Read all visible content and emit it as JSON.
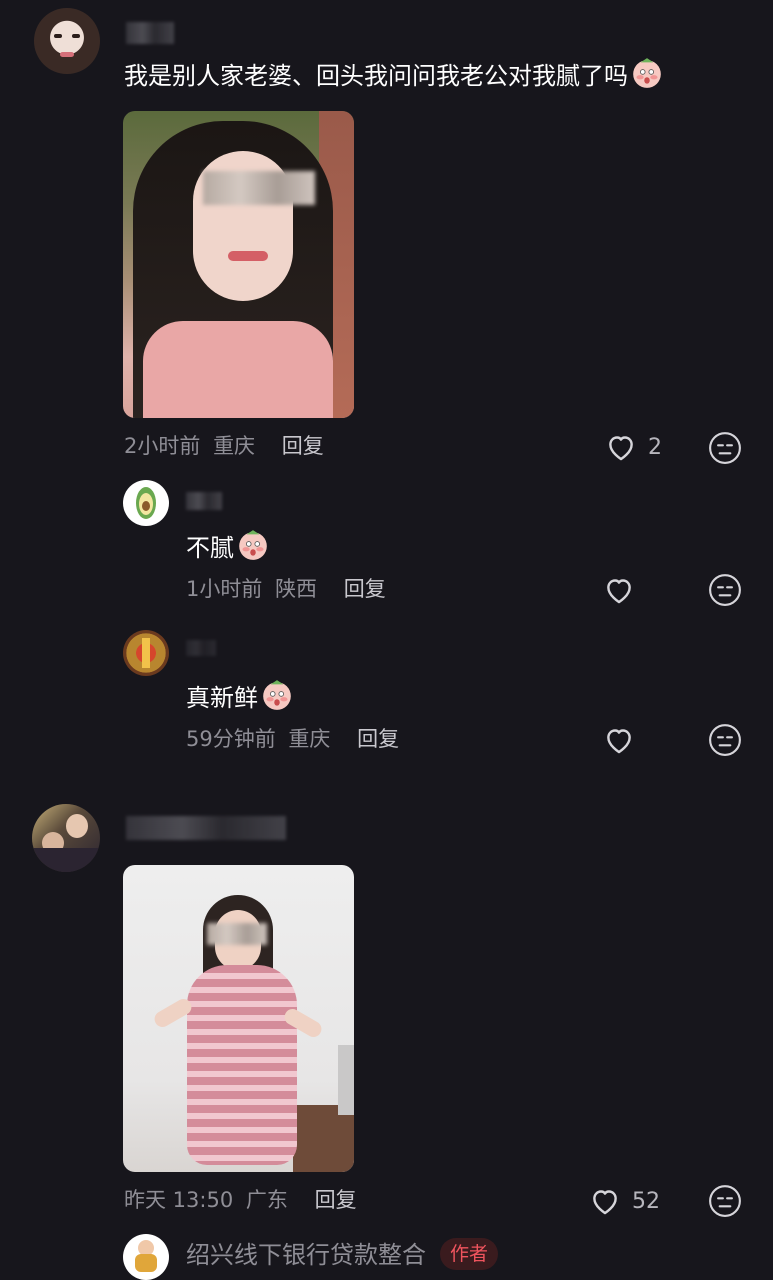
{
  "comments": [
    {
      "text": "我是别人家老婆、回头我问问我老公对我腻了吗",
      "time": "2小时前",
      "location": "重庆",
      "reply": "回复",
      "likes": "2"
    },
    {
      "text": "不腻",
      "time": "1小时前",
      "location": "陕西",
      "reply": "回复",
      "likes": ""
    },
    {
      "text": "真新鲜",
      "time": "59分钟前",
      "location": "重庆",
      "reply": "回复",
      "likes": ""
    },
    {
      "text": "",
      "time": "昨天 13:50",
      "location": "广东",
      "reply": "回复",
      "likes": "52"
    }
  ],
  "bottom_reply": {
    "text": "绍兴线下银行贷款整合",
    "tag": "作者"
  },
  "icons": {
    "like": "heart-outline-icon",
    "dislike": "meh-face-icon",
    "emoji": "blush-face-emoji"
  },
  "colors": {
    "background": "#17161c",
    "meta_text": "#8f8e96",
    "author_tag": "#f0545e"
  }
}
